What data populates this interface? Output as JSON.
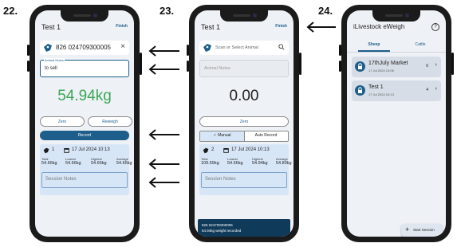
{
  "steps": [
    "22.",
    "23.",
    "24."
  ],
  "screen22": {
    "title": "Test 1",
    "action": "Finish",
    "tag_number": "826 024709300005",
    "notes_label": "Animal Notes",
    "notes_value": "to sell",
    "weight": "54.94kg",
    "zero_label": "Zero",
    "reweigh_label": "Reweigh",
    "record_label": "Record",
    "count": "1",
    "datetime": "17 Jul 2024 10:13",
    "stats": [
      {
        "label": "Total",
        "value": "54.66kg"
      },
      {
        "label": "Lowest",
        "value": "54.66kg"
      },
      {
        "label": "Highest",
        "value": "54.66kg"
      },
      {
        "label": "Average",
        "value": "54.66kg"
      }
    ],
    "session_notes": "Session Notes"
  },
  "screen23": {
    "title": "Test 1",
    "action": "Finish",
    "search_placeholder": "Scan or Select Animal",
    "notes_placeholder": "Animal Notes",
    "weight": "0.00",
    "zero_label": "Zero",
    "manual_label": "Manual",
    "auto_label": "Auto Record",
    "count": "2",
    "datetime": "17 Jul 2024 10:13",
    "stats": [
      {
        "label": "Total",
        "value": "109.59kg"
      },
      {
        "label": "Lowest",
        "value": "54.66kg"
      },
      {
        "label": "Highest",
        "value": "54.94kg"
      },
      {
        "label": "Average",
        "value": "54.80kg"
      }
    ],
    "session_notes": "Session Notes",
    "toast_line1": "826 024709300005",
    "toast_line2": "54.94kg weight recorded"
  },
  "screen24": {
    "title": "iLivestock eWeigh",
    "tabs": [
      "Sheep",
      "Cattle"
    ],
    "sessions": [
      {
        "name": "17thJuly Market",
        "date": "17 Jul 2024 13:06",
        "count": "6"
      },
      {
        "name": "Test 1",
        "date": "17 Jul 2024 10:13",
        "count": "4"
      }
    ],
    "start_label": "Start Session"
  },
  "colors": {
    "accent": "#1d5e8a",
    "weight_green": "#3aa655",
    "panel_blue": "#d7e6f7",
    "dark_navy": "#103a5a"
  }
}
